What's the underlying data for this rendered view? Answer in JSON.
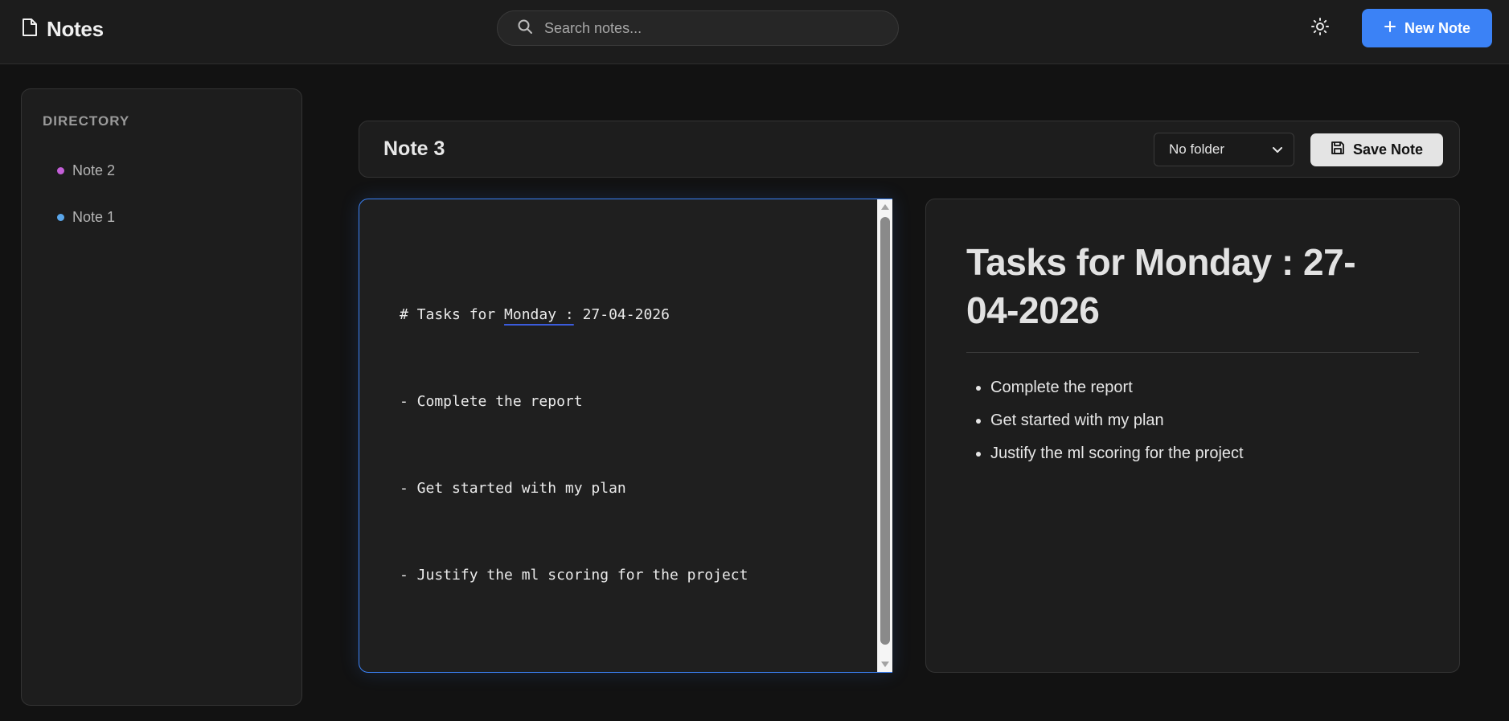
{
  "header": {
    "app_title": "Notes",
    "search_placeholder": "Search notes...",
    "new_note_label": "New Note",
    "accent_color": "#3b82f6"
  },
  "sidebar": {
    "heading": "DIRECTORY",
    "items": [
      {
        "label": "Note 2",
        "dot_color": "#c45fd8"
      },
      {
        "label": "Note 1",
        "dot_color": "#5aa6ea"
      }
    ]
  },
  "note": {
    "title": "Note 3",
    "folder_selected": "No folder",
    "save_label": "Save Note"
  },
  "editor": {
    "line_1_prefix": "# Tasks for ",
    "line_1_underlined": "Monday :",
    "line_1_suffix": " 27-04-2026",
    "line_2": "- Complete the report",
    "line_3": "- Get started with my plan",
    "line_4": "- Justify the ml scoring for the project"
  },
  "preview": {
    "heading": "Tasks for Monday : 27-04-2026",
    "items": [
      "Complete the report",
      "Get started with my plan",
      "Justify the ml scoring for the project"
    ]
  }
}
